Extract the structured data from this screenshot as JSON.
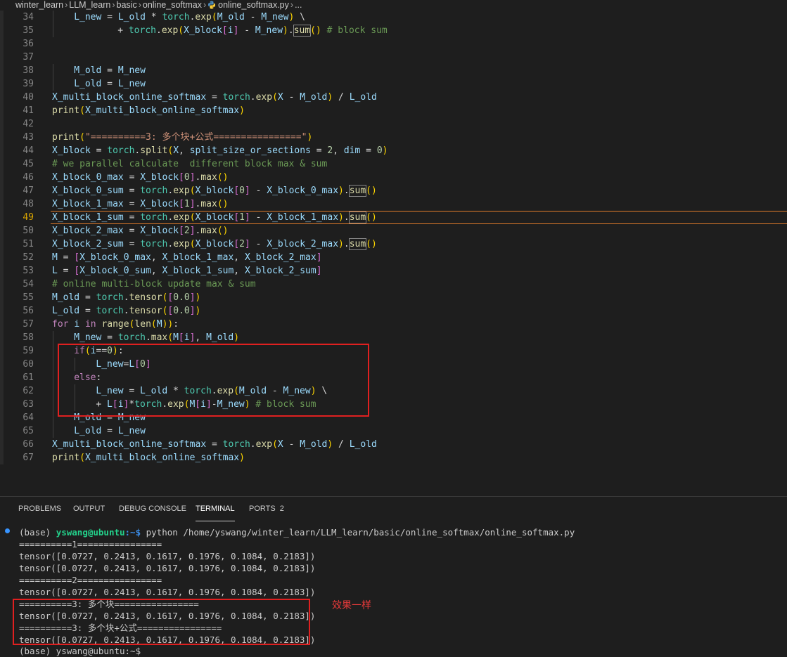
{
  "breadcrumb": [
    "winter_learn",
    "LLM_learn",
    "basic",
    "online_softmax",
    "online_softmax.py",
    "..."
  ],
  "editor": {
    "line_numbers": [
      "34",
      "35",
      "36",
      "37",
      "38",
      "39",
      "40",
      "41",
      "42",
      "43",
      "44",
      "45",
      "46",
      "47",
      "48",
      "49",
      "50",
      "51",
      "52",
      "53",
      "54",
      "55",
      "56",
      "57",
      "58",
      "59",
      "60",
      "61",
      "62",
      "63",
      "64",
      "65",
      "66",
      "67"
    ],
    "active_line": "49",
    "lines": [
      "L_new = L_old * torch.exp(M_old - M_new) \\",
      "+ torch.exp(X_block[i] - M_new).sum() # block sum",
      "",
      "",
      "M_old = M_new",
      "L_old = L_new",
      "X_multi_block_online_softmax = torch.exp(X - M_old) / L_old",
      "print(X_multi_block_online_softmax)",
      "",
      "print(\"==========3: 多个块+公式================\")",
      "X_block = torch.split(X, split_size_or_sections = 2, dim = 0)",
      "# we parallel calculate  different block max & sum",
      "X_block_0_max = X_block[0].max()",
      "X_block_0_sum = torch.exp(X_block[0] - X_block_0_max).sum()",
      "X_block_1_max = X_block[1].max()",
      "X_block_1_sum = torch.exp(X_block[1] - X_block_1_max).sum()",
      "X_block_2_max = X_block[2].max()",
      "X_block_2_sum = torch.exp(X_block[2] - X_block_2_max).sum()",
      "M = [X_block_0_max, X_block_1_max, X_block_2_max]",
      "L = [X_block_0_sum, X_block_1_sum, X_block_2_sum]",
      "# online multi-block update max & sum",
      "M_old = torch.tensor([0.0])",
      "L_old = torch.tensor([0.0])",
      "for i in range(len(M)):",
      "M_new = torch.max(M[i], M_old)",
      "if(i==0):",
      "L_new=L[0]",
      "else:",
      "L_new = L_old * torch.exp(M_old - M_new) \\",
      "+ L[i]*torch.exp(M[i]-M_new) # block sum",
      "M_old = M_new",
      "L_old = L_new",
      "X_multi_block_online_softmax = torch.exp(X - M_old) / L_old",
      "print(X_multi_block_online_softmax)"
    ]
  },
  "panel": {
    "tabs": [
      {
        "label": "PROBLEMS"
      },
      {
        "label": "OUTPUT"
      },
      {
        "label": "DEBUG CONSOLE"
      },
      {
        "label": "TERMINAL",
        "active": true
      },
      {
        "label": "PORTS",
        "badge": "2"
      }
    ]
  },
  "terminal": {
    "prompt_env": "(base)",
    "prompt_user": "yswang@ubuntu",
    "prompt_path": ":~$",
    "command": "python /home/yswang/winter_learn/LLM_learn/basic/online_softmax/online_softmax.py",
    "output": [
      "==========1================",
      "tensor([0.0727, 0.2413, 0.1617, 0.1976, 0.1084, 0.2183])",
      "tensor([0.0727, 0.2413, 0.1617, 0.1976, 0.1084, 0.2183])",
      "==========2================",
      "tensor([0.0727, 0.2413, 0.1617, 0.1976, 0.1084, 0.2183])",
      "==========3: 多个块================",
      "tensor([0.0727, 0.2413, 0.1617, 0.1976, 0.1084, 0.2183])",
      "==========3: 多个块+公式================",
      "tensor([0.0727, 0.2413, 0.1617, 0.1976, 0.1084, 0.2183])"
    ],
    "next_prompt": "(base) yswang@ubuntu:~$"
  },
  "annotation": "效果一样",
  "colors": {
    "background": "#1e1e1e",
    "annotation_box": "#e02020",
    "current_line_border": "#e07b2a",
    "prompt_user": "#23d18b",
    "prompt_path": "#3b8eea"
  }
}
